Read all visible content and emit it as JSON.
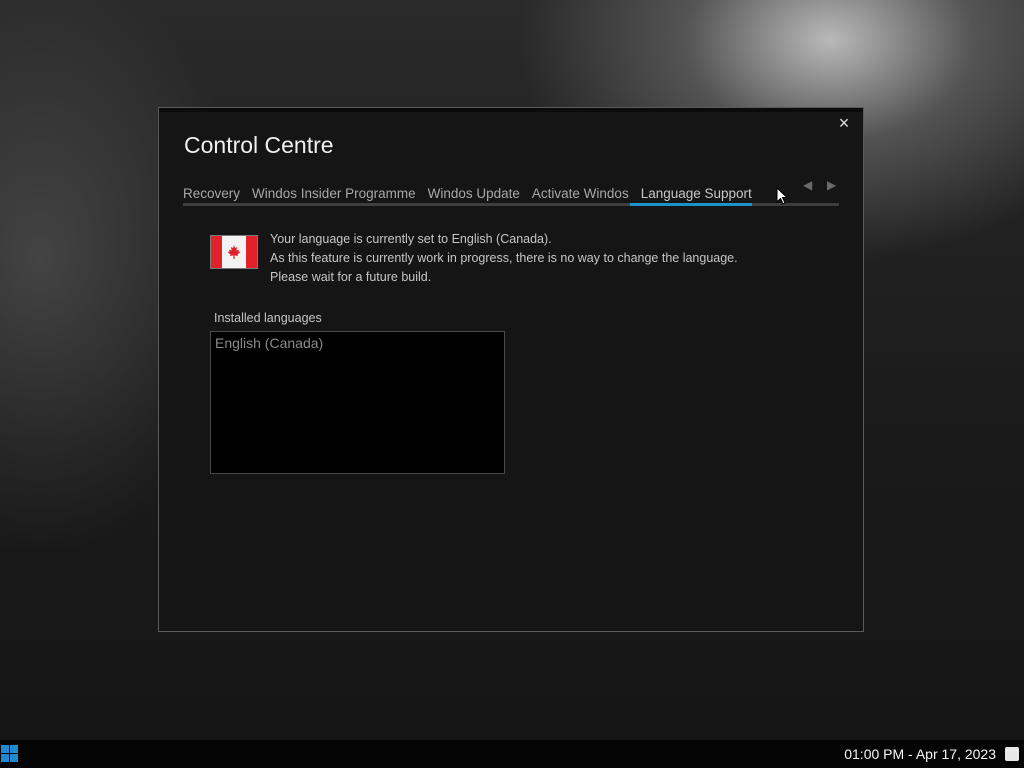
{
  "window": {
    "title": "Control Centre",
    "close_label": "×"
  },
  "tabs": [
    {
      "label": "Recovery"
    },
    {
      "label": "Windos Insider Programme"
    },
    {
      "label": "Windos Update"
    },
    {
      "label": "Activate Windos"
    },
    {
      "label": "Language Support",
      "active": true
    }
  ],
  "tab_nav": {
    "prev_icon": "◀",
    "next_icon": "▶"
  },
  "language": {
    "flag_icon": "canada-flag-icon",
    "message_lines": [
      "Your language is currently set to English (Canada).",
      "As this feature is currently work in progress, there is no way to change the language.",
      "Please wait for a future build."
    ],
    "installed_label": "Installed languages",
    "installed": [
      "English (Canada)"
    ]
  },
  "taskbar": {
    "clock": "01:00 PM - Apr 17, 2023"
  },
  "colors": {
    "accent": "#1e90c8",
    "flag_red": "#e2222b"
  }
}
